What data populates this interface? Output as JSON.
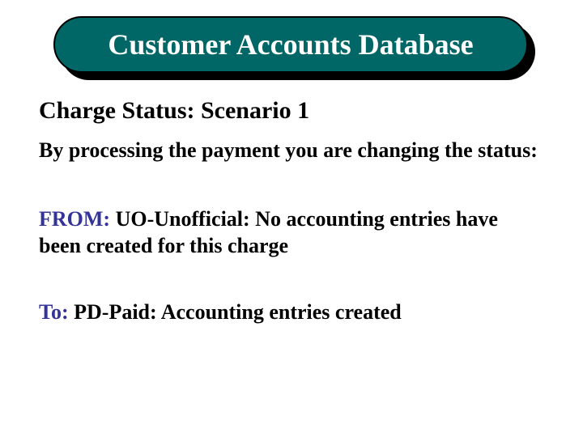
{
  "title": "Customer Accounts Database",
  "subtitle": "Charge Status: Scenario 1",
  "intro": "By processing the payment you are changing the status:",
  "from": {
    "label": "FROM:",
    "text": " UO-Unofficial: No accounting entries have been created for this charge"
  },
  "to": {
    "label": "To:",
    "text": "  PD-Paid:  Accounting entries created"
  }
}
